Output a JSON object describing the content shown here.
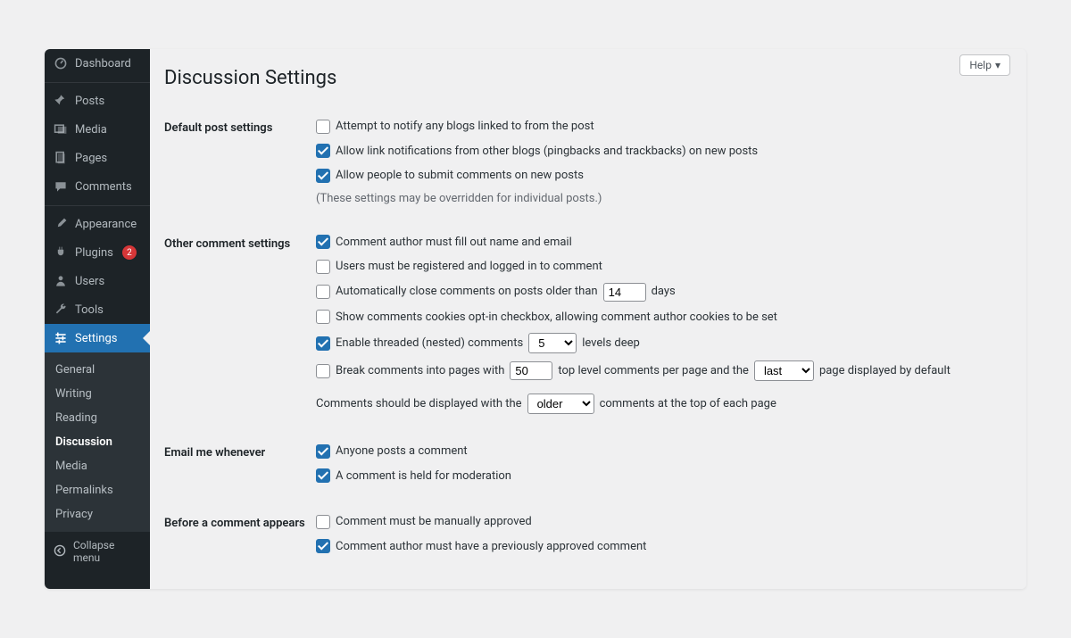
{
  "help_label": "Help",
  "sidebar": {
    "items": [
      {
        "label": "Dashboard",
        "icon": "dashboard"
      },
      {
        "label": "Posts",
        "icon": "pin"
      },
      {
        "label": "Media",
        "icon": "media"
      },
      {
        "label": "Pages",
        "icon": "pages"
      },
      {
        "label": "Comments",
        "icon": "comment"
      },
      {
        "label": "Appearance",
        "icon": "brush"
      },
      {
        "label": "Plugins",
        "icon": "plug",
        "badge": "2"
      },
      {
        "label": "Users",
        "icon": "user"
      },
      {
        "label": "Tools",
        "icon": "wrench"
      },
      {
        "label": "Settings",
        "icon": "settings",
        "active": true
      }
    ],
    "submenu": [
      "General",
      "Writing",
      "Reading",
      "Discussion",
      "Media",
      "Permalinks",
      "Privacy"
    ],
    "submenu_current": "Discussion",
    "collapse": "Collapse menu"
  },
  "page_title": "Discussion Settings",
  "sections": {
    "default_post": {
      "heading": "Default post settings",
      "opt_notify": {
        "label": "Attempt to notify any blogs linked to from the post",
        "checked": false
      },
      "opt_pingbacks": {
        "label": "Allow link notifications from other blogs (pingbacks and trackbacks) on new posts",
        "checked": true
      },
      "opt_allow_comments": {
        "label": "Allow people to submit comments on new posts",
        "checked": true
      },
      "note": "(These settings may be overridden for individual posts.)"
    },
    "other": {
      "heading": "Other comment settings",
      "opt_name_email": {
        "label": "Comment author must fill out name and email",
        "checked": true
      },
      "opt_registered": {
        "label": "Users must be registered and logged in to comment",
        "checked": false
      },
      "opt_auto_close": {
        "prefix": "Automatically close comments on posts older than",
        "value": "14",
        "suffix": "days",
        "checked": false
      },
      "opt_cookies": {
        "label": "Show comments cookies opt-in checkbox, allowing comment author cookies to be set",
        "checked": false
      },
      "opt_threaded": {
        "prefix": "Enable threaded (nested) comments",
        "value": "5",
        "suffix": "levels deep",
        "checked": true
      },
      "opt_paginate": {
        "prefix": "Break comments into pages with",
        "per_page": "50",
        "mid": "top level comments per page and the",
        "default_page": "last",
        "suffix": "page displayed by default",
        "checked": false
      },
      "sort": {
        "prefix": "Comments should be displayed with the",
        "value": "older",
        "suffix": "comments at the top of each page"
      }
    },
    "email": {
      "heading": "Email me whenever",
      "opt_posts": {
        "label": "Anyone posts a comment",
        "checked": true
      },
      "opt_moderation": {
        "label": "A comment is held for moderation",
        "checked": true
      }
    },
    "before": {
      "heading": "Before a comment appears",
      "opt_manual": {
        "label": "Comment must be manually approved",
        "checked": false
      },
      "opt_previously": {
        "label": "Comment author must have a previously approved comment",
        "checked": true
      }
    }
  }
}
